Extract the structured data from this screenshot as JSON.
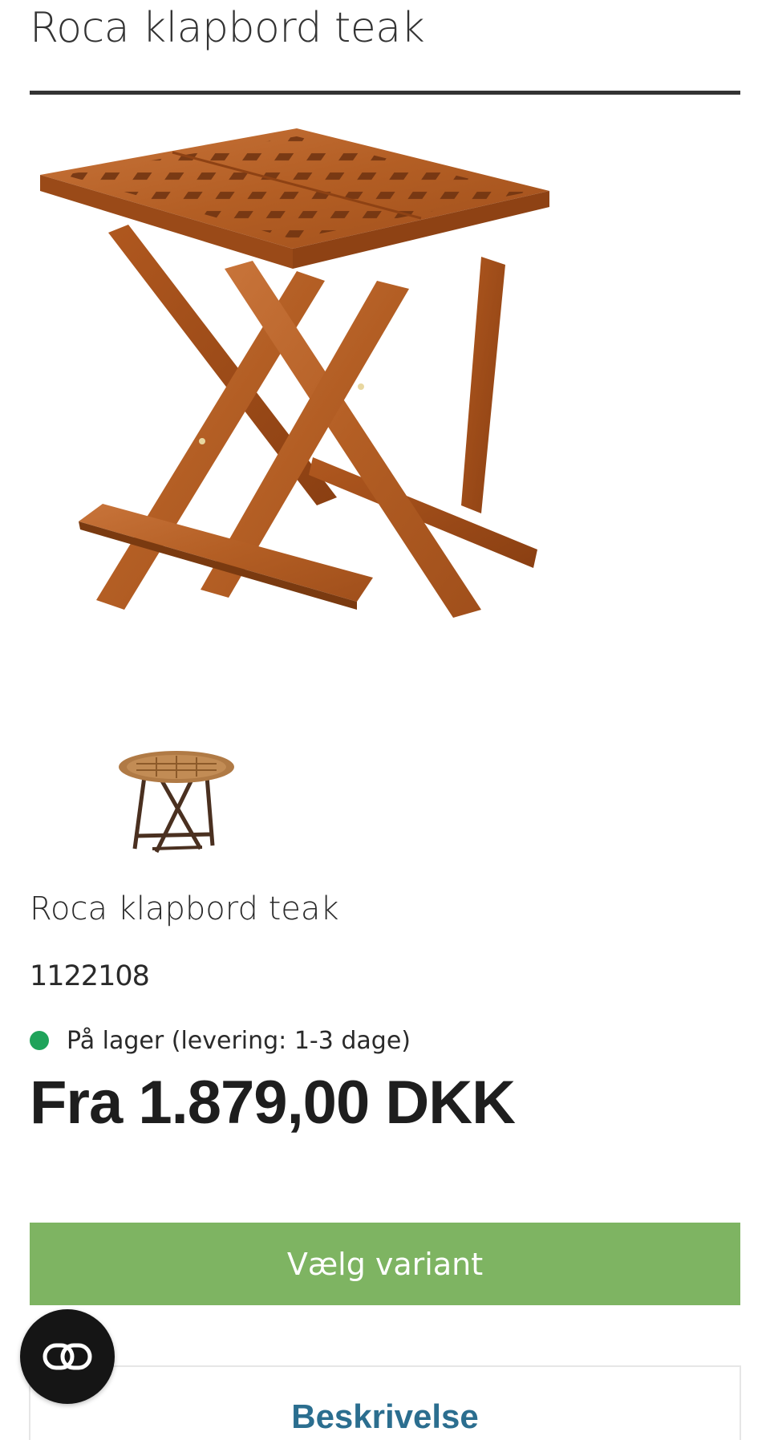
{
  "product": {
    "title": "Roca klapbord teak",
    "name": "Roca klapbord teak",
    "sku": "1122108",
    "stock_text": "På lager (levering: 1-3 dage)",
    "stock_color": "#1fa35a",
    "price": "Fra 1.879,00 DKK"
  },
  "gallery": {
    "main_image": "square-teak-folding-table",
    "thumbnails": [
      "round-teak-folding-table"
    ]
  },
  "actions": {
    "choose_variant_label": "Vælg variant",
    "button_color": "#7eb462"
  },
  "tabs": {
    "description_label": "Beskrivelse",
    "label_color": "#2b6e8f"
  },
  "chat": {
    "icon": "link-chat-icon"
  }
}
